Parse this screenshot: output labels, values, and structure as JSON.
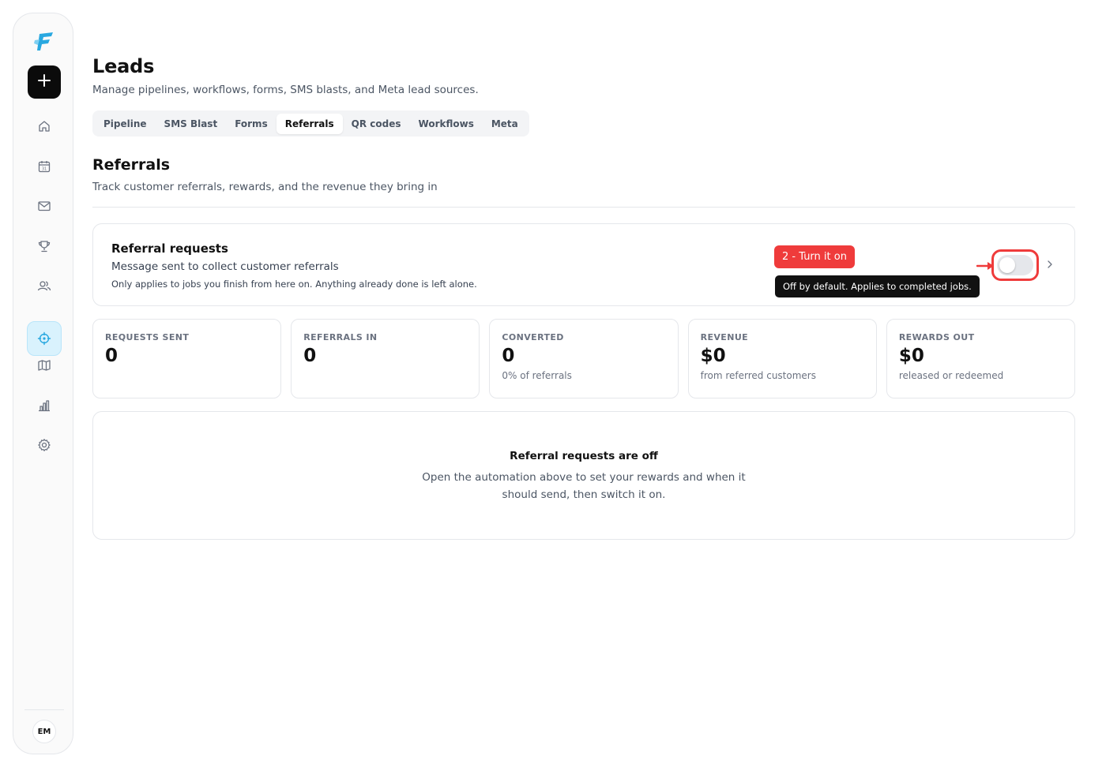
{
  "sidebar": {
    "avatar_initials": "EM",
    "nav_icons": [
      "home-icon",
      "calendar-icon",
      "mail-icon",
      "trophy-icon",
      "users-icon",
      "crosshair-icon",
      "map-icon",
      "bar-chart-icon",
      "gear-icon"
    ],
    "active_item": "crosshair-icon"
  },
  "header": {
    "title": "Leads",
    "subtitle": "Manage pipelines, workflows, forms, SMS blasts, and Meta lead sources."
  },
  "tabs": [
    {
      "label": "Pipeline",
      "active": false
    },
    {
      "label": "SMS Blast",
      "active": false
    },
    {
      "label": "Forms",
      "active": false
    },
    {
      "label": "Referrals",
      "active": true
    },
    {
      "label": "QR codes",
      "active": false
    },
    {
      "label": "Workflows",
      "active": false
    },
    {
      "label": "Meta",
      "active": false
    }
  ],
  "section": {
    "title": "Referrals",
    "subtitle": "Track customer referrals, rewards, and the revenue they bring in"
  },
  "referral_card": {
    "title": "Referral requests",
    "subtitle": "Message sent to collect customer referrals",
    "note": "Only applies to jobs you finish from here on. Anything already done is left alone.",
    "callout": "2 - Turn it on",
    "tooltip": "Off by default. Applies to completed jobs.",
    "toggle_on": false
  },
  "stats": [
    {
      "label": "REQUESTS SENT",
      "value": "0",
      "sub": ""
    },
    {
      "label": "REFERRALS IN",
      "value": "0",
      "sub": ""
    },
    {
      "label": "CONVERTED",
      "value": "0",
      "sub": "0% of referrals"
    },
    {
      "label": "REVENUE",
      "value": "$0",
      "sub": "from referred customers"
    },
    {
      "label": "REWARDS OUT",
      "value": "$0",
      "sub": "released or redeemed"
    }
  ],
  "empty_state": {
    "title": "Referral requests are off",
    "body": "Open the automation above to set your rewards and when it should send, then switch it on."
  },
  "colors": {
    "accent": "#29a8e0",
    "active_nav_bg": "#d9f2fd",
    "callout_red": "#ef3b3b",
    "tooltip_bg": "#111111"
  }
}
